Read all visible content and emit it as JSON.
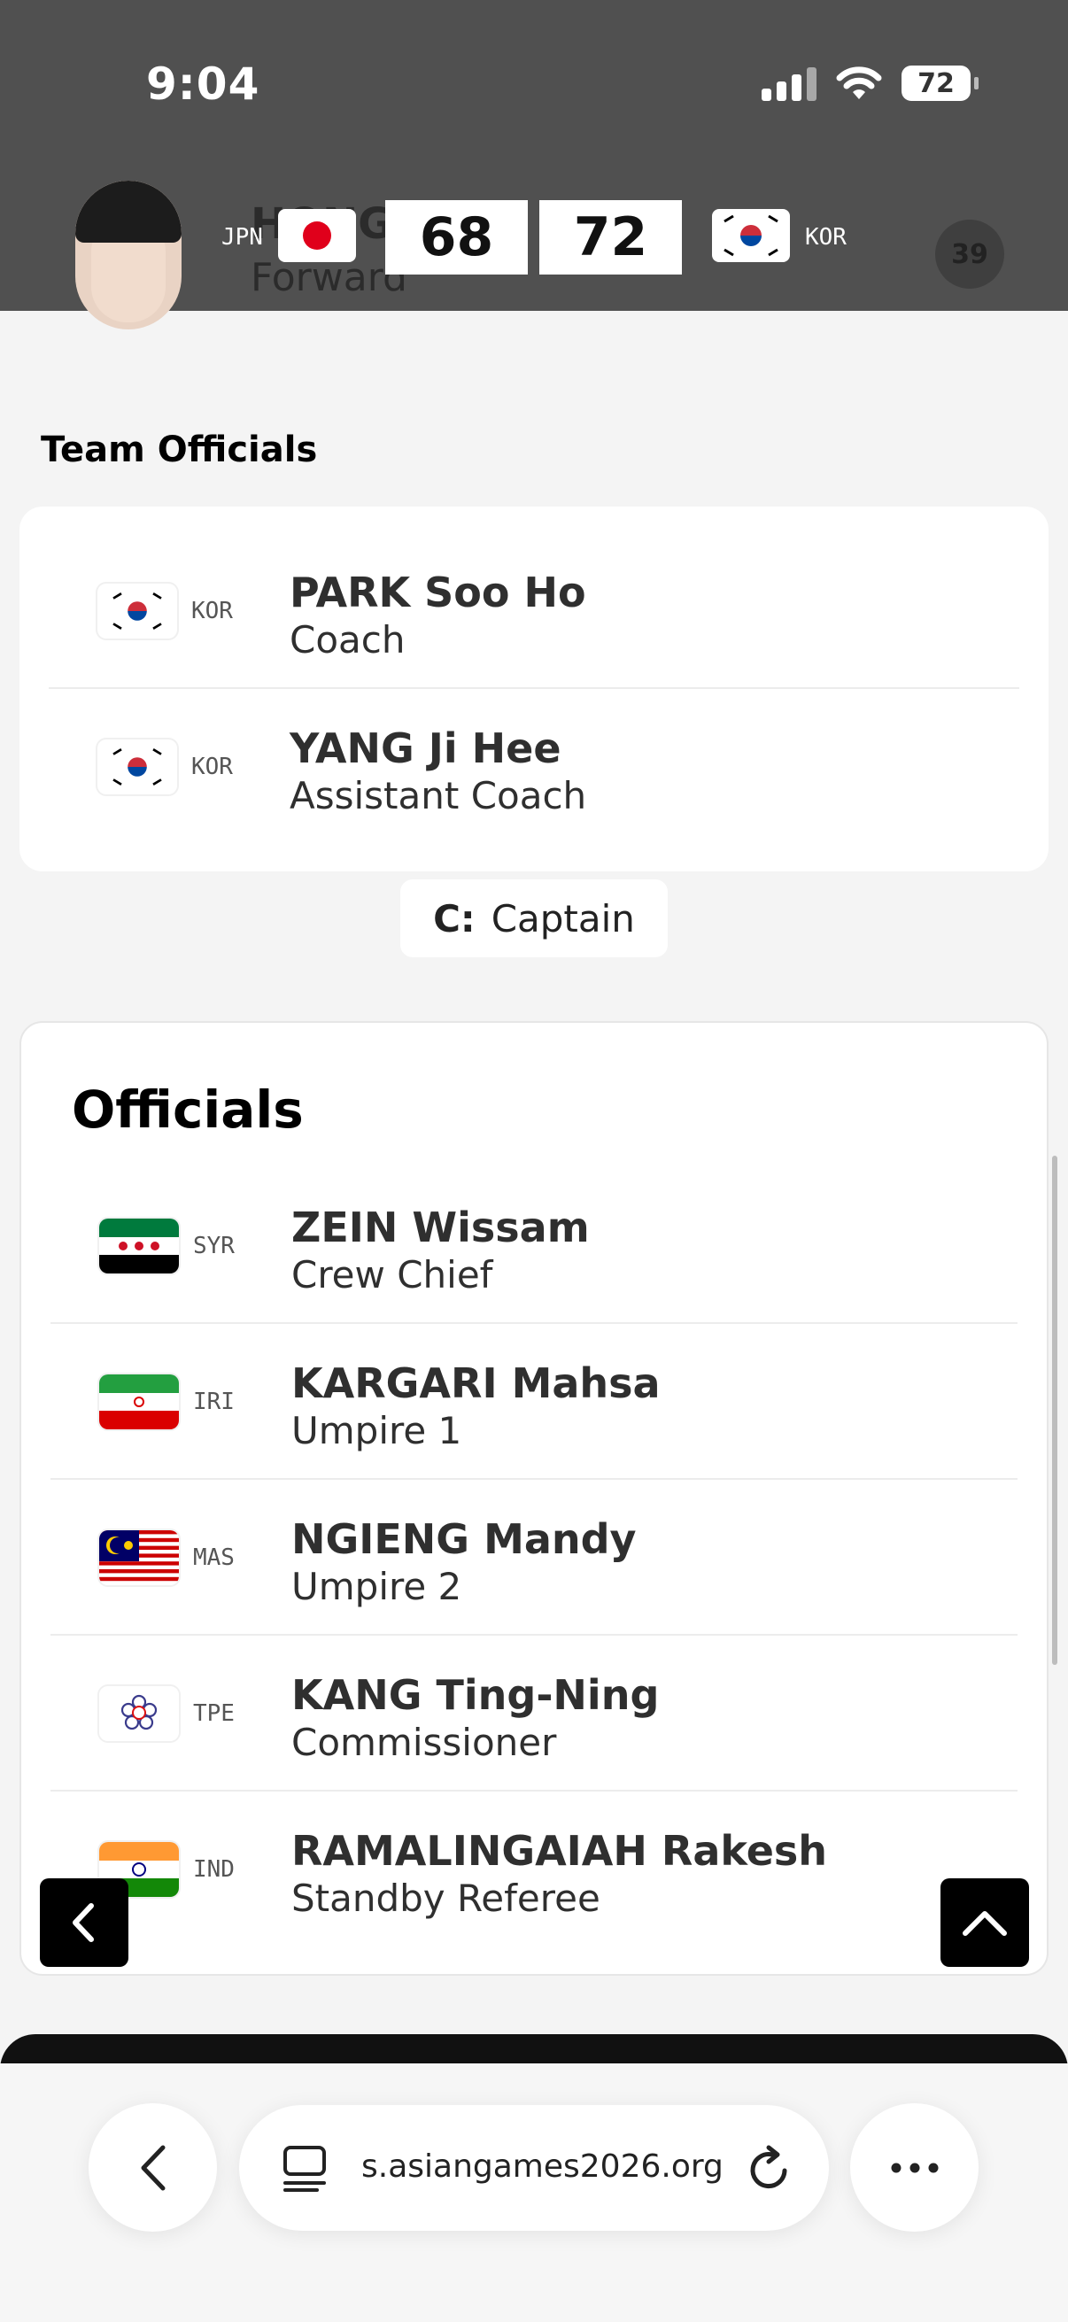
{
  "status": {
    "time": "9:04",
    "battery": "72"
  },
  "scoreboard": {
    "player_name": "HONG",
    "player_position": "Forward",
    "home_code": "JPN",
    "home_score": "68",
    "away_score": "72",
    "away_code": "KOR",
    "badge": "39"
  },
  "team_officials": {
    "title": "Team Officials",
    "rows": [
      {
        "code": "KOR",
        "name": "PARK Soo Ho",
        "role": "Coach"
      },
      {
        "code": "KOR",
        "name": "YANG Ji Hee",
        "role": "Assistant Coach"
      }
    ]
  },
  "legend": {
    "key": "C:",
    "value": "Captain"
  },
  "officials": {
    "title": "Officials",
    "rows": [
      {
        "code": "SYR",
        "name": "ZEIN Wissam",
        "role": "Crew Chief"
      },
      {
        "code": "IRI",
        "name": "KARGARI Mahsa",
        "role": "Umpire 1"
      },
      {
        "code": "MAS",
        "name": "NGIENG Mandy",
        "role": "Umpire 2"
      },
      {
        "code": "TPE",
        "name": "KANG Ting-Ning",
        "role": "Commissioner"
      },
      {
        "code": "IND",
        "name": "RAMALINGAIAH Rakesh",
        "role": "Standby Referee"
      }
    ]
  },
  "browser": {
    "url": "s.asiangames2026.org"
  },
  "icons": [
    "back-arrow-icon",
    "scroll-top-icon",
    "chevron-left-icon",
    "tabs-icon",
    "reload-icon",
    "more-icon"
  ]
}
